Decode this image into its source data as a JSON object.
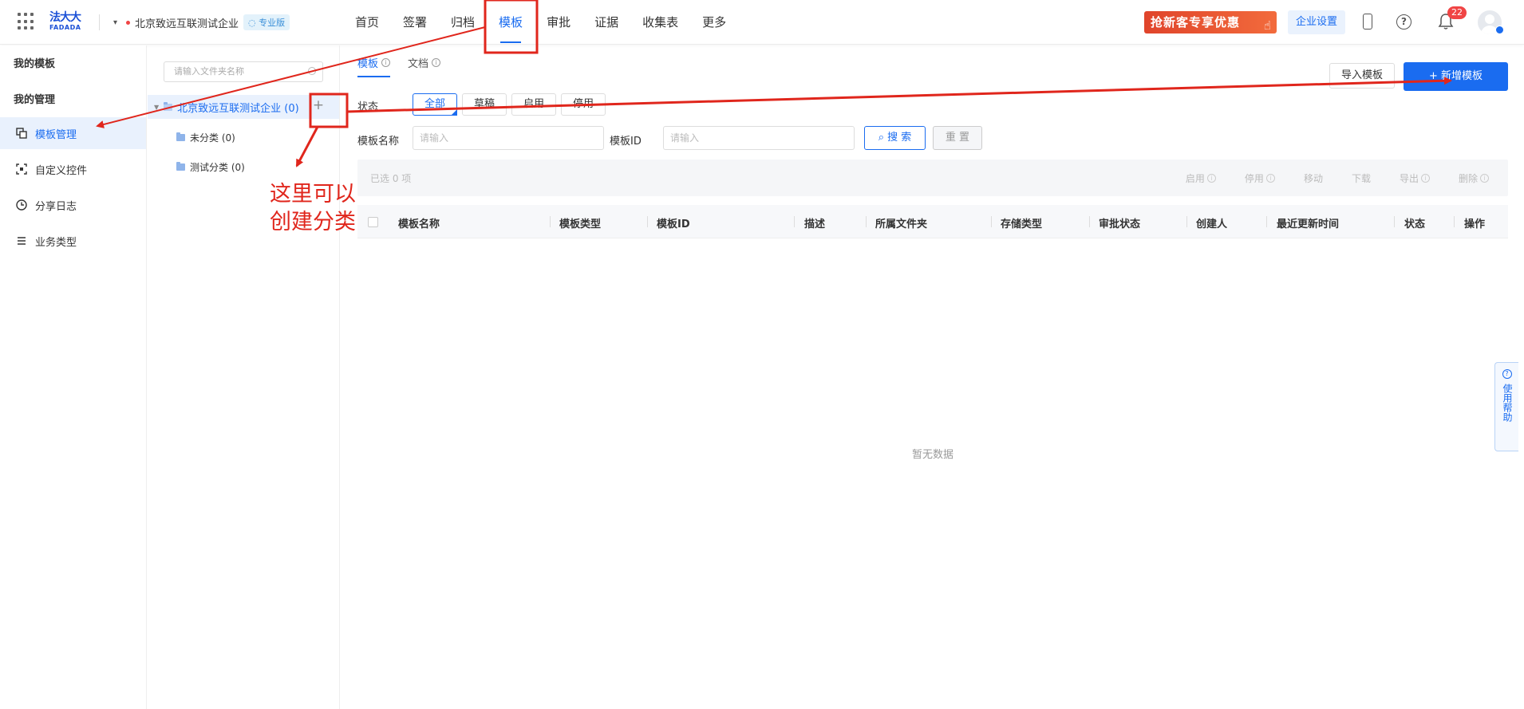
{
  "topbar": {
    "logo_cn": "法大大",
    "logo_en": "FADADA",
    "company_name": "北京致远互联测试企业",
    "company_badge": "专业版",
    "nav": [
      {
        "label": "首页"
      },
      {
        "label": "签署"
      },
      {
        "label": "归档"
      },
      {
        "label": "模板",
        "active": true
      },
      {
        "label": "审批"
      },
      {
        "label": "证据"
      },
      {
        "label": "收集表"
      },
      {
        "label": "更多"
      }
    ],
    "promo_label": "抢新客专享优惠",
    "enterprise_settings": "企业设置",
    "notification_count": "22"
  },
  "sidebar": {
    "group_my_templates": "我的模板",
    "group_my_management": "我的管理",
    "items": [
      {
        "label": "模板管理",
        "icon": "template-manage-icon",
        "active": true
      },
      {
        "label": "自定义控件",
        "icon": "custom-control-icon"
      },
      {
        "label": "分享日志",
        "icon": "clock-icon"
      },
      {
        "label": "业务类型",
        "icon": "list-icon"
      }
    ]
  },
  "tree": {
    "search_placeholder": "请输入文件夹名称",
    "root_label": "北京致远互联测试企业 (0)",
    "children": [
      {
        "label": "未分类 (0)"
      },
      {
        "label": "测试分类 (0)"
      }
    ]
  },
  "annotation": {
    "line1": "这里可以",
    "line2": "创建分类",
    "color": "#e0261c"
  },
  "main": {
    "tabs": [
      {
        "label": "模板",
        "active": true
      },
      {
        "label": "文档"
      }
    ],
    "import_button": "导入模板",
    "new_button": "+ 新增模板",
    "status_label": "状态",
    "status_options": [
      "全部",
      "草稿",
      "启用",
      "停用"
    ],
    "filter_name_label": "模板名称",
    "filter_name_placeholder": "请输入",
    "filter_id_label": "模板ID",
    "filter_id_placeholder": "请输入",
    "search_button": "搜 索",
    "reset_button": "重 置",
    "selected_text": "已选  0  项",
    "bulk_actions": [
      "启用",
      "停用",
      "移动",
      "下载",
      "导出",
      "删除"
    ],
    "columns": [
      "模板名称",
      "模板类型",
      "模板ID",
      "描述",
      "所属文件夹",
      "存储类型",
      "审批状态",
      "创建人",
      "最近更新时间",
      "状态",
      "操作"
    ],
    "empty_text": "暂无数据"
  },
  "help": {
    "label": "使用帮助"
  },
  "colors": {
    "accent": "#1a6cf0",
    "annotation_red": "#e0261c"
  }
}
